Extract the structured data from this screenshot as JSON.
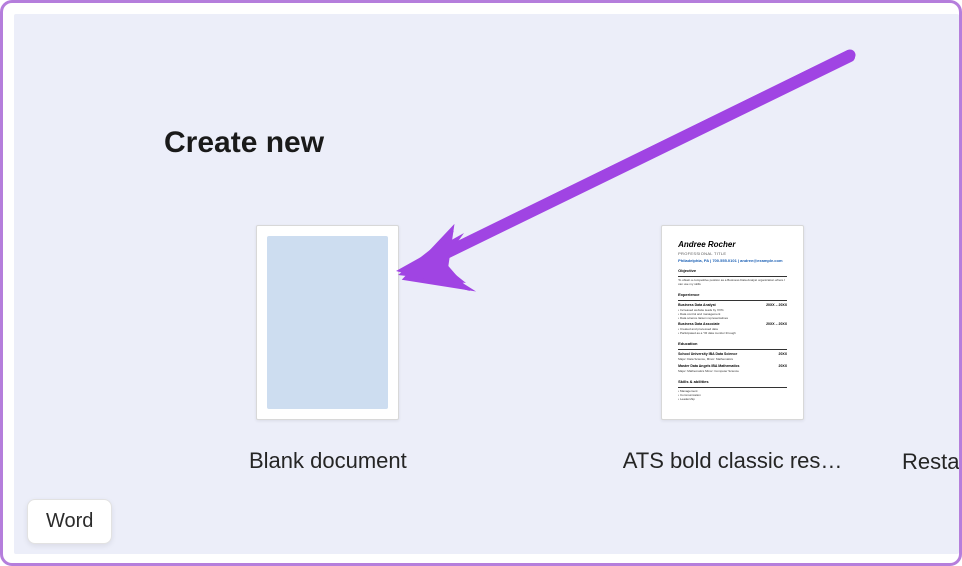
{
  "section": {
    "title": "Create new"
  },
  "templates": [
    {
      "label": "Blank document",
      "type": "blank"
    },
    {
      "label": "ATS bold classic res…",
      "type": "resume"
    },
    {
      "label": "Restau",
      "type": "partial"
    }
  ],
  "resume_preview": {
    "name": "Andree Rocher",
    "subtitle": "PROFESSIONAL TITLE",
    "contact": "Philadelphia, PA | 700.555.0101 | andree@example.com",
    "sections": {
      "objective": "Objective",
      "experience": "Experience",
      "education": "Education",
      "skills": "Skills & abilities"
    },
    "jobs": [
      {
        "title": "Business Data Analyst",
        "dates": "20XX – 20XX"
      },
      {
        "title": "Business Data Associate",
        "dates": "20XX – 20XX"
      }
    ],
    "schools": [
      {
        "name": "School University IBA Data Science",
        "date": "20XX"
      },
      {
        "name": "Master Data Angels IBA Mathematics",
        "date": "20XX"
      }
    ]
  },
  "app_label": "Word",
  "colors": {
    "accent": "#a044e3",
    "panel_bg": "#eceef9",
    "blank_fill": "#cdddf0",
    "frame": "#b57edc"
  }
}
